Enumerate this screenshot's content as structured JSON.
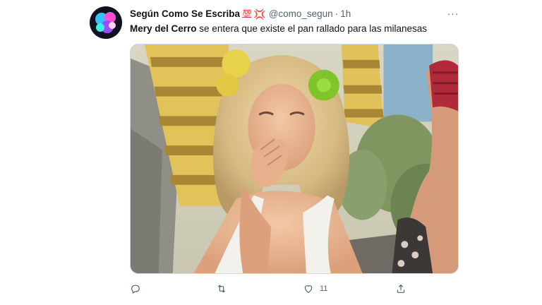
{
  "tweet": {
    "display_name": "Según Como Se Escriba",
    "emoji_badges": [
      "💯",
      "💢"
    ],
    "handle": "@como_segun",
    "separator": "·",
    "time": "1h",
    "text_bold": "Mery del Cerro",
    "text_rest": " se entera que existe el pan rallado para las milanesas",
    "more_icon": "···"
  },
  "actions": {
    "reply": {
      "icon": "reply-icon",
      "count": ""
    },
    "retweet": {
      "icon": "retweet-icon",
      "count": ""
    },
    "like": {
      "icon": "heart-icon",
      "count": "11"
    },
    "share": {
      "icon": "share-icon",
      "count": ""
    }
  },
  "colors": {
    "text_primary": "#0f1419",
    "text_secondary": "#536471",
    "border": "#cfd9de",
    "emoji_red": "#e0245e"
  }
}
